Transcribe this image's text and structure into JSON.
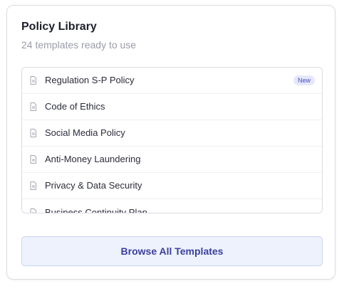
{
  "header": {
    "title": "Policy Library",
    "subtitle": "24 templates ready to use"
  },
  "policies": [
    {
      "label": "Regulation S-P Policy",
      "badge": "New",
      "icon": "document-icon"
    },
    {
      "label": "Code of Ethics",
      "icon": "document-icon"
    },
    {
      "label": "Social Media Policy",
      "icon": "document-icon"
    },
    {
      "label": "Anti-Money Laundering",
      "icon": "document-icon"
    },
    {
      "label": "Privacy & Data Security",
      "icon": "document-icon"
    },
    {
      "label": "Business Continuity Plan",
      "icon": "document-icon"
    }
  ],
  "actions": {
    "browse_label": "Browse All Templates"
  },
  "colors": {
    "accent": "#3c3f9c",
    "button_bg": "#eef2fd",
    "badge_bg": "#e6e8fb",
    "badge_text": "#4a4fb8"
  }
}
